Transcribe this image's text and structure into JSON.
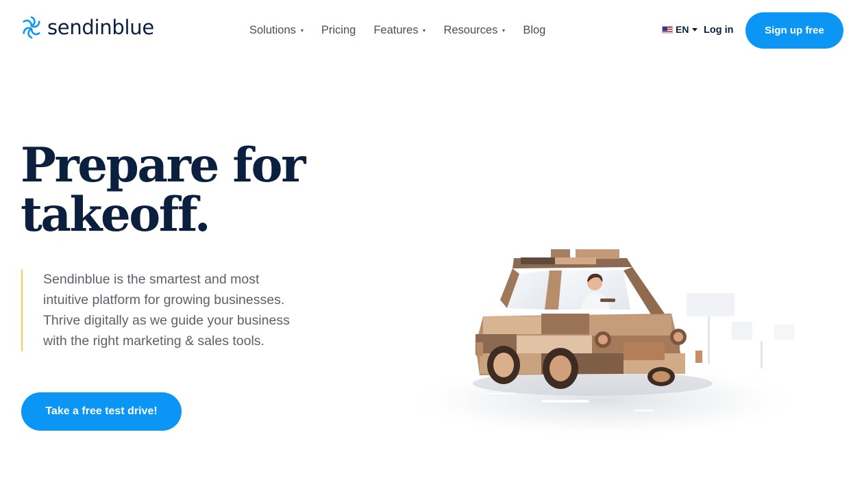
{
  "header": {
    "logo": {
      "text": "sendinblue",
      "icon": "sendinblue-logo-icon",
      "color": "#0b96f5"
    },
    "nav": [
      {
        "label": "Solutions",
        "has_dropdown": true
      },
      {
        "label": "Pricing",
        "has_dropdown": false
      },
      {
        "label": "Features",
        "has_dropdown": true
      },
      {
        "label": "Resources",
        "has_dropdown": true
      },
      {
        "label": "Blog",
        "has_dropdown": false
      }
    ],
    "language": {
      "label": "EN",
      "flag": "us-flag-icon"
    },
    "login_label": "Log in",
    "signup_label": "Sign up free"
  },
  "hero": {
    "headline_line1": "Prepare for",
    "headline_line2": "takeoff.",
    "description_lines": [
      "Sendinblue is the smartest and most",
      "intuitive platform for growing businesses.",
      "Thrive digitally as we guide your business",
      "with the right marketing & sales tools."
    ],
    "cta_label": "Take a free test drive!",
    "illustration": "wooden-toy-car-image"
  },
  "colors": {
    "accent": "#0b96f5",
    "heading": "#0b1f3f",
    "body_text": "#5b606b",
    "quote_bar": "#f2d34b"
  }
}
